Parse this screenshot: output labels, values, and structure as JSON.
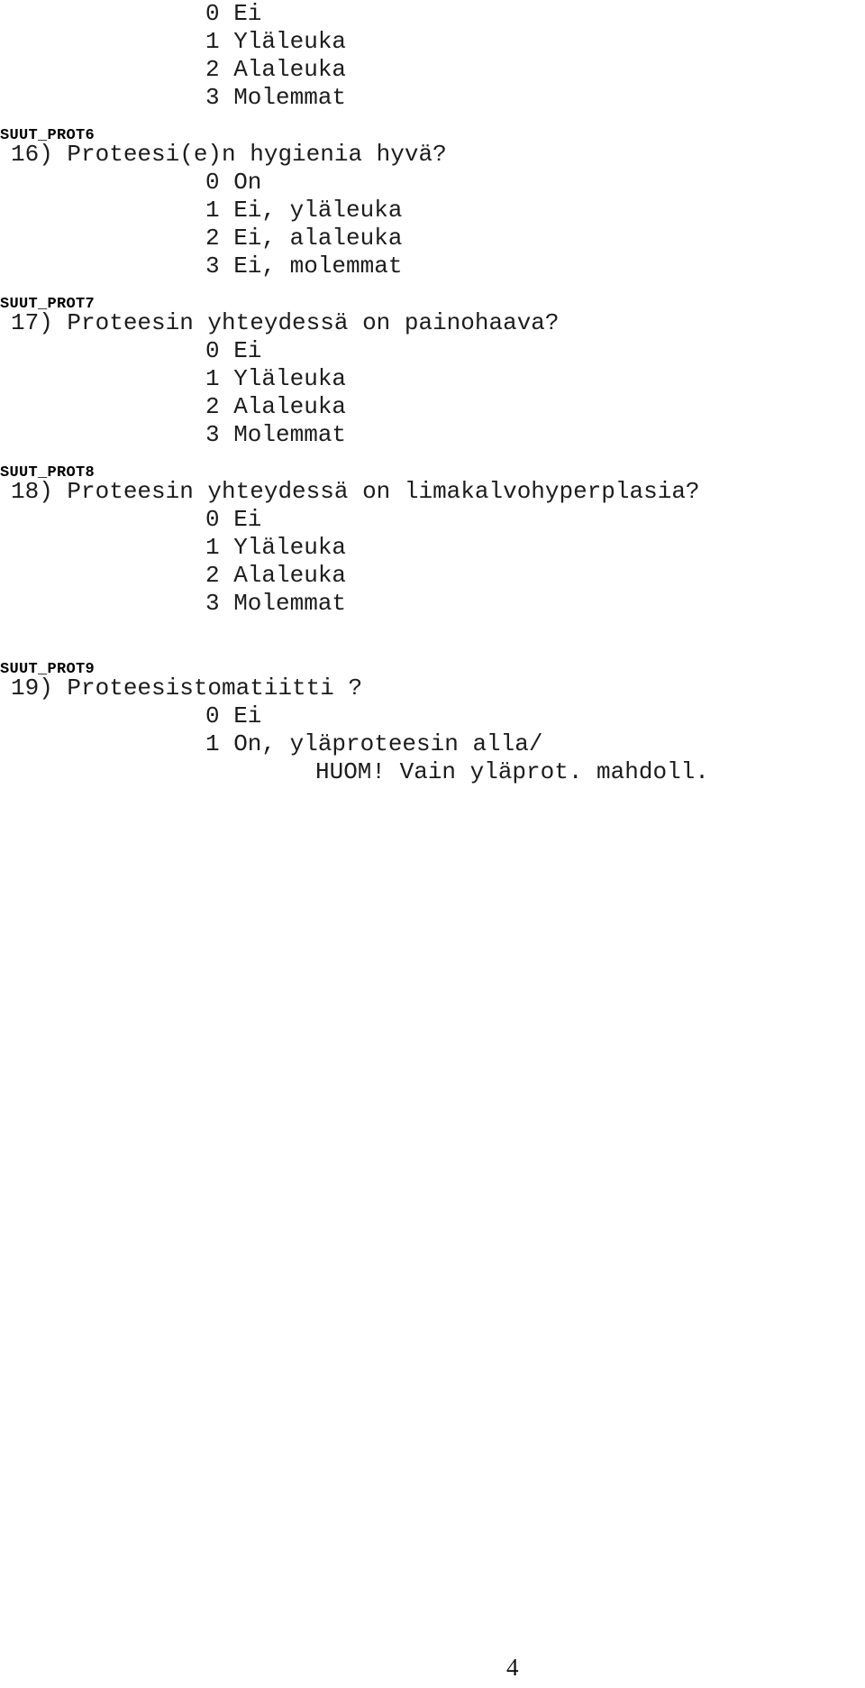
{
  "document": {
    "type": "questionnaire-page",
    "language": "fi",
    "page_number": "4",
    "leading_options": [
      "0 Ei",
      "1 Yläleuka",
      "2 Alaleuka",
      "3 Molemmat"
    ],
    "sections": [
      {
        "variable": "SUUT_PROT6",
        "question": "16) Proteesi(e)n hygienia hyvä?",
        "options": [
          "0 On",
          "1 Ei, yläleuka",
          "2 Ei, alaleuka",
          "3 Ei, molemmat"
        ],
        "notes": []
      },
      {
        "variable": "SUUT_PROT7",
        "question": "17) Proteesin yhteydessä on painohaava?",
        "options": [
          "0 Ei",
          "1 Yläleuka",
          "2 Alaleuka",
          "3 Molemmat"
        ],
        "notes": []
      },
      {
        "variable": "SUUT_PROT8",
        "question": "18) Proteesin yhteydessä on limakalvohyperplasia?",
        "options": [
          "0 Ei",
          "1 Yläleuka",
          "2 Alaleuka",
          "3 Molemmat"
        ],
        "notes": []
      },
      {
        "variable": "SUUT_PROT9",
        "question": "19) Proteesistomatiitti ?",
        "options": [
          "0 Ei",
          "1 On, yläproteesin alla/"
        ],
        "notes": [
          "HUOM! Vain yläprot. mahdoll."
        ]
      }
    ]
  }
}
